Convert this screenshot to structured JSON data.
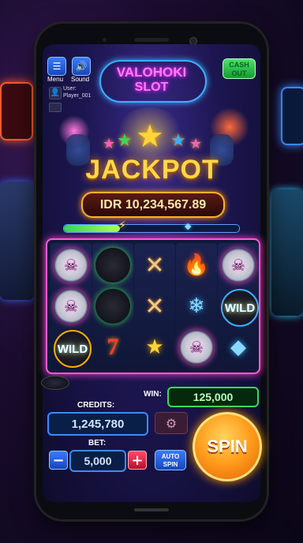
{
  "header": {
    "menu_label": "Menu",
    "sound_label": "Sound",
    "logo_line1": "VALOHOKI",
    "logo_line2": "SLOT",
    "cash_out_line1": "CASH",
    "cash_out_line2": "OUT"
  },
  "user": {
    "label": "User:",
    "name": "Player_001"
  },
  "jackpot": {
    "title": "JACKPOT",
    "amount": "IDR 10,234,567.89",
    "progress_fraction": 0.32
  },
  "reels": [
    [
      "hockey-mask-icon",
      "hockey-mask-icon",
      "hockey-puck-wild-icon"
    ],
    [
      "hockey-puck-icon",
      "hockey-puck-icon",
      "seven-icon"
    ],
    [
      "crossed-sticks-icon",
      "crossed-sticks-icon",
      "gold-star-icon"
    ],
    [
      "fire-icon",
      "snowflake-icon",
      "hockey-mask-icon"
    ],
    [
      "hockey-mask-icon",
      "wild-icon",
      "diamond-icon"
    ]
  ],
  "symbols": {
    "wild_text": "WILD",
    "seven_text": "7"
  },
  "win": {
    "label": "WIN:",
    "value": "125,000"
  },
  "credits": {
    "label": "CREDITS:",
    "value": "1,245,780"
  },
  "bet": {
    "label": "BET:",
    "value": "5,000",
    "minus": "−",
    "plus": "+"
  },
  "auto_spin": {
    "line1": "AUTO",
    "line2": "SPIN"
  },
  "spin_label": "SPIN",
  "colors": {
    "accent_pink": "#ff5ad2",
    "accent_gold": "#ffd84a",
    "win_green": "#3ad85a",
    "panel_blue": "#3b8cff"
  }
}
